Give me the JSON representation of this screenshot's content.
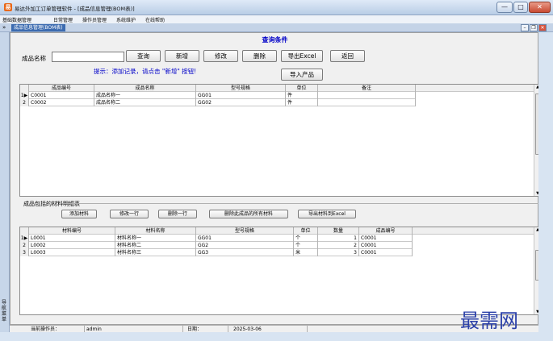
{
  "window": {
    "title": "易达外加工订单管理软件 - [成品信息管理(BOM表)]",
    "app_icon": "易",
    "minimize_glyph": "—",
    "maximize_glyph": "□",
    "close_glyph": "✕"
  },
  "menu": [
    "基础数据管理",
    "日常管理",
    "操作员管理",
    "系统维护",
    "在线帮助"
  ],
  "mdi": {
    "arrow": "»",
    "tab_title": "成品信息管理(BOM表)",
    "minimize_glyph": "–",
    "restore_glyph": "❐",
    "close_glyph": "✕"
  },
  "sidebar": {
    "label": "导航菜单"
  },
  "query": {
    "title": "查询条件",
    "product_name_label": "成品名称",
    "product_name_value": "",
    "buttons": {
      "search": "查询",
      "add": "新增",
      "edit": "修改",
      "delete": "删除",
      "export_excel": "导出Excel",
      "back": "返回",
      "import_products": "导入产品"
    },
    "hint": "提示：添加记录，请点击 \"新增\" 按钮!"
  },
  "products_table": {
    "columns": [
      "成品编号",
      "成品名称",
      "型号规格",
      "单位",
      "备注"
    ],
    "rows": [
      {
        "index": "1",
        "marker": "▶",
        "code": "C0001",
        "name": "成品名称一",
        "model": "GG01",
        "unit": "件",
        "note": ""
      },
      {
        "index": "2",
        "marker": "",
        "code": "C0002",
        "name": "成品名称二",
        "model": "GG02",
        "unit": "件",
        "note": ""
      }
    ]
  },
  "materials_section": {
    "title": "成品包括的材料明细表",
    "buttons": {
      "add_material": "添加材料",
      "edit_row": "修改一行",
      "delete_row": "删除一行",
      "delete_all": "删除此成品的所有材料",
      "export_excel": "导出材料到Excel"
    }
  },
  "materials_table": {
    "columns": [
      "材料编号",
      "材料名称",
      "型号规格",
      "单位",
      "数量",
      "成品编号"
    ],
    "rows": [
      {
        "index": "1",
        "marker": "▶",
        "code": "L0001",
        "name": "材料名称一",
        "model": "GG01",
        "unit": "个",
        "qty": "1",
        "product": "C0001"
      },
      {
        "index": "2",
        "marker": "",
        "code": "L0002",
        "name": "材料名称二",
        "model": "GG2",
        "unit": "个",
        "qty": "2",
        "product": "C0001"
      },
      {
        "index": "3",
        "marker": "",
        "code": "L0003",
        "name": "材料名称三",
        "model": "GG3",
        "unit": "米",
        "qty": "3",
        "product": "C0001"
      }
    ]
  },
  "status": {
    "operator_label": "当前操作员：",
    "operator_value": "admin",
    "date_label": "日期：",
    "date_value": "2025-03-06"
  },
  "watermark": "最需网",
  "colors": {
    "accent": "#0000c8",
    "titlebar": "#c4d6ec",
    "close_button": "#c94a32"
  },
  "icons": [
    "app-logo-icon",
    "minimize-icon",
    "maximize-icon",
    "close-icon",
    "row-pointer-icon",
    "scroll-up-icon",
    "scroll-down-icon"
  ]
}
